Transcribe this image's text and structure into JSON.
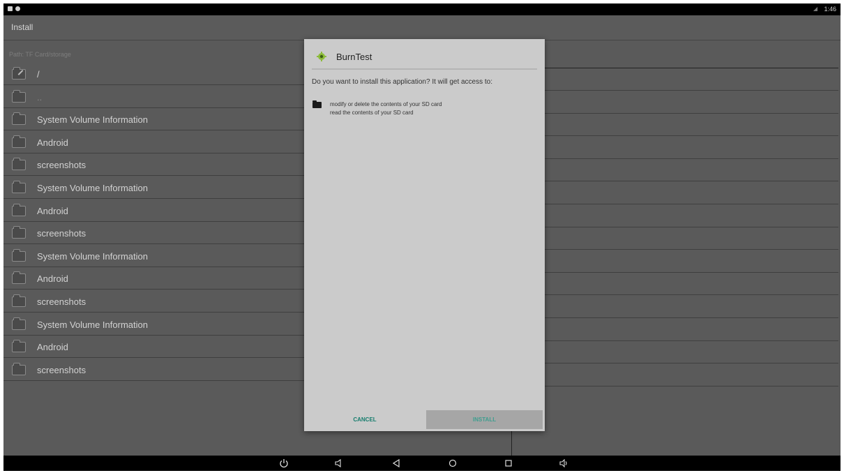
{
  "status_bar": {
    "time": "1:46"
  },
  "header": {
    "title": "Install"
  },
  "path": {
    "label": "Path:",
    "value": "TF Card/storage"
  },
  "files": [
    {
      "name": "/",
      "icon": "folder-edit-icon"
    },
    {
      "name": "..",
      "icon": "folder-icon"
    },
    {
      "name": "System Volume Information",
      "icon": "folder-icon"
    },
    {
      "name": "Android",
      "icon": "folder-icon"
    },
    {
      "name": "screenshots",
      "icon": "folder-icon"
    },
    {
      "name": "System Volume Information",
      "icon": "folder-icon"
    },
    {
      "name": "Android",
      "icon": "folder-icon"
    },
    {
      "name": "screenshots",
      "icon": "folder-icon"
    },
    {
      "name": "System Volume Information",
      "icon": "folder-icon"
    },
    {
      "name": "Android",
      "icon": "folder-icon"
    },
    {
      "name": "screenshots",
      "icon": "folder-icon"
    },
    {
      "name": "System Volume Information",
      "icon": "folder-icon"
    },
    {
      "name": "Android",
      "icon": "folder-icon"
    },
    {
      "name": "screenshots",
      "icon": "folder-icon"
    }
  ],
  "dialog": {
    "app_name": "BurnTest",
    "question": "Do you want to install this application? It will get access to:",
    "permissions": [
      "modify or delete the contents of your SD card",
      "read the contents of your SD card"
    ],
    "cancel_label": "CANCEL",
    "install_label": "INSTALL",
    "accent_color": "#167d6d"
  },
  "nav_bar": {
    "buttons": [
      "power-icon",
      "volume-down-icon",
      "back-icon",
      "home-icon",
      "recents-icon",
      "volume-up-icon"
    ]
  }
}
